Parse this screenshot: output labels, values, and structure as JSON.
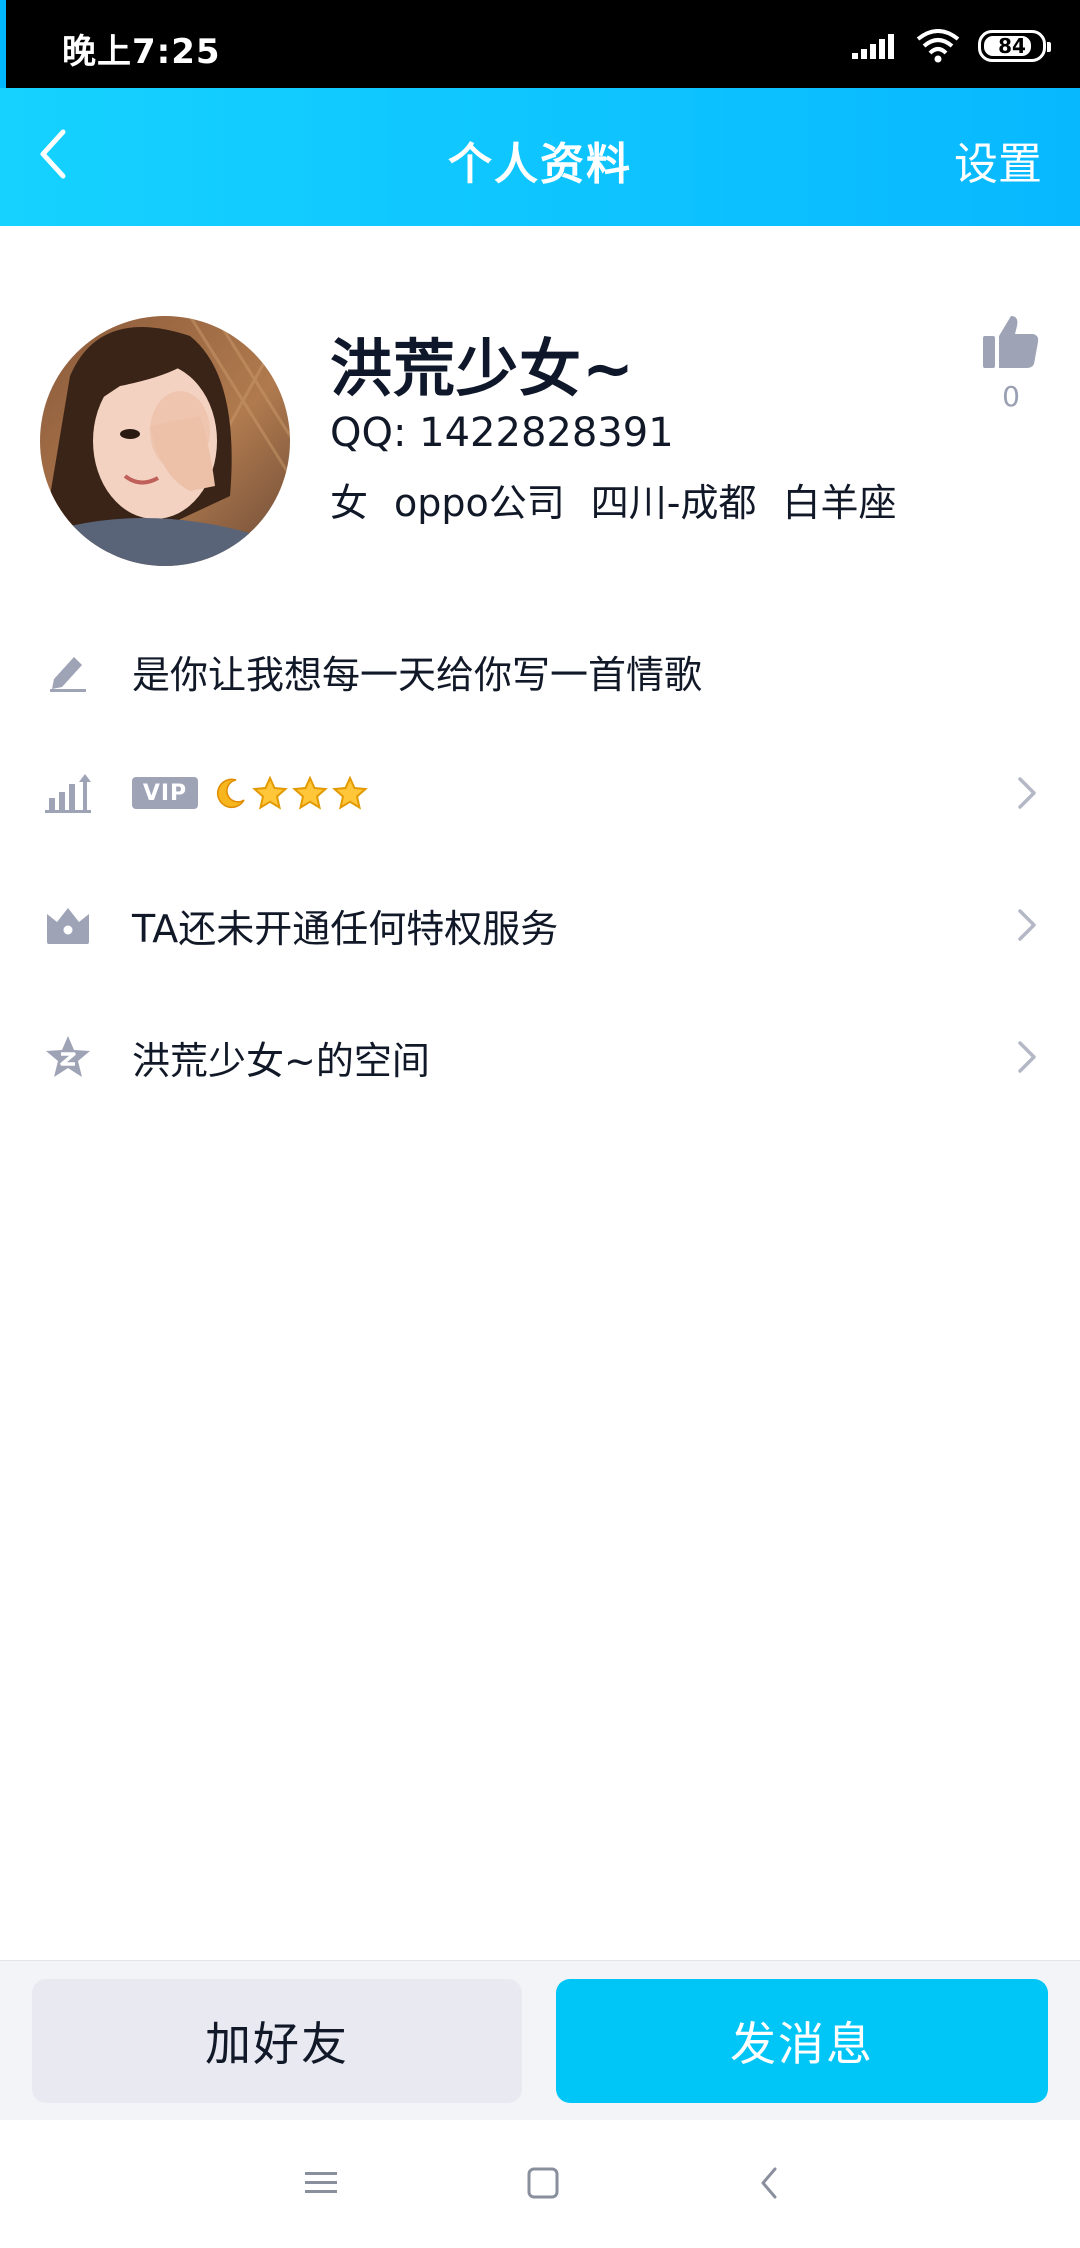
{
  "status_bar": {
    "time": "晚上7:25",
    "battery": "84",
    "battery_level": 0.84
  },
  "header": {
    "title": "个人资料",
    "settings": "设置"
  },
  "profile": {
    "name": "洪荒少女~",
    "qq": "QQ: 1422828391",
    "gender": "女",
    "company": "oppo公司",
    "location": "四川-成都",
    "zodiac": "白羊座",
    "like_count": "0"
  },
  "rows": {
    "signature": "是你让我想每一天给你写一首情歌",
    "vip_badge": "VIP",
    "privilege": "TA还未开通任何特权服务",
    "space": "洪荒少女~的空间"
  },
  "buttons": {
    "add_friend": "加好友",
    "send_message": "发消息"
  },
  "colors": {
    "accent": "#00c6f7",
    "header_start": "#15d2ff",
    "header_end": "#08b8ff",
    "icon_gray": "#9ea3b6"
  },
  "icons": [
    "back-arrow-icon",
    "thumbs-up-icon",
    "edit-pencil-icon",
    "level-chart-icon",
    "crown-icon",
    "qzone-star-icon",
    "chevron-right-icon",
    "menu-icon",
    "home-square-icon",
    "back-triangle-icon",
    "signal-icon",
    "wifi-icon",
    "battery-icon"
  ]
}
